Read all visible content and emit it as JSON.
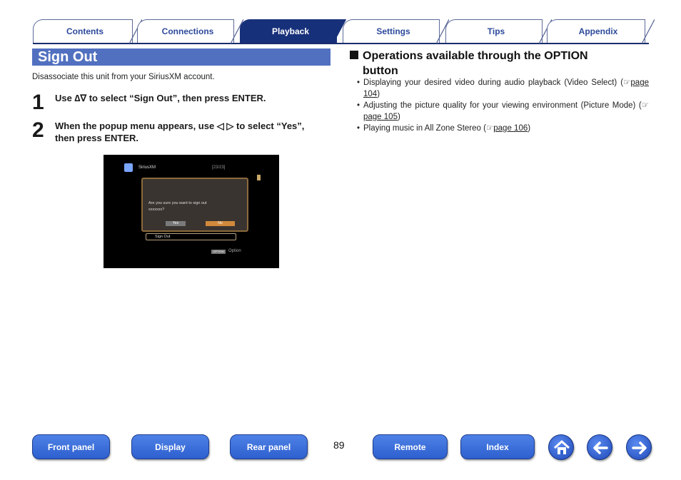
{
  "tabs": [
    "Contents",
    "Connections",
    "Playback",
    "Settings",
    "Tips",
    "Appendix"
  ],
  "active_tab": "Playback",
  "section": {
    "title": "Sign Out",
    "intro": "Disassociate this unit from your SiriusXM account."
  },
  "steps": [
    {
      "num": "1",
      "text": "Use ∆∇ to select “Sign Out”, then press ENTER."
    },
    {
      "num": "2",
      "line1": "When the popup menu appears, use ◁ ▷ to select “Yes”,",
      "line2": "then press ENTER."
    }
  ],
  "screenshot": {
    "source": "SiriusXM",
    "count": "[23/23]",
    "message_line1": "Are you sure you want to sign out",
    "message_line2": "xxxxxxx?",
    "yes": "Yes",
    "no": "No",
    "menu_item": "Sign Out",
    "option_badge": "OPTION",
    "option_label": "Option"
  },
  "operations": {
    "title_line1": "Operations available through the OPTION",
    "title_line2": "button",
    "items": [
      {
        "pre": "Displaying your desired video during audio playback (Video Select) (",
        "page": "page 104",
        "post": ")"
      },
      {
        "pre": "Adjusting the picture quality for your viewing environment (Picture Mode) (",
        "page": "page 105",
        "post": ")"
      },
      {
        "pre": "Playing music in All Zone Stereo (",
        "page": "page 106",
        "post": ")"
      }
    ]
  },
  "page_number": "89",
  "bottom_nav": [
    "Front panel",
    "Display",
    "Rear panel",
    "Remote",
    "Index"
  ],
  "nav_icons": [
    "home-icon",
    "back-arrow-icon",
    "forward-arrow-icon"
  ],
  "colors": {
    "accent": "#17307a",
    "section_bar": "#5170c0",
    "button": "#2e5fcf"
  }
}
